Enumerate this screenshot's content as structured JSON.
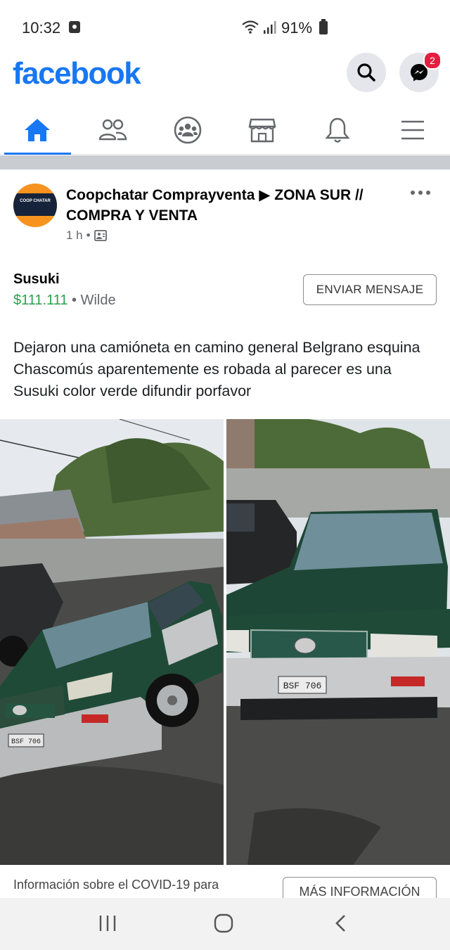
{
  "status": {
    "time": "10:32",
    "battery": "91%"
  },
  "header": {
    "logo": "facebook",
    "messenger_badge": "2"
  },
  "nav": {
    "active": "home"
  },
  "post": {
    "group": "Coopchatar Comprayventa",
    "arrow": "▶",
    "subgroup": "ZONA SUR // COMPRA Y VENTA",
    "time": "1 h",
    "avatar_text": "COOP CHATAR",
    "item_name": "Susuki",
    "price": "$111.111",
    "location": "Wilde",
    "message_button": "ENVIAR MENSAJE",
    "body": "Dejaron una camióneta en camino general Belgrano esquina Chascomús aparentemente es robada al parecer es una Susuki color verde difundir porfavor",
    "plate_left": "BSF 706",
    "plate_right": "BSF 706"
  },
  "covid": {
    "text": "Información sobre el COVID-19 para",
    "button": "MÁS INFORMACIÓN"
  },
  "colors": {
    "brand": "#1877f2",
    "price": "#2aa14a",
    "badge": "#e41e3f"
  }
}
